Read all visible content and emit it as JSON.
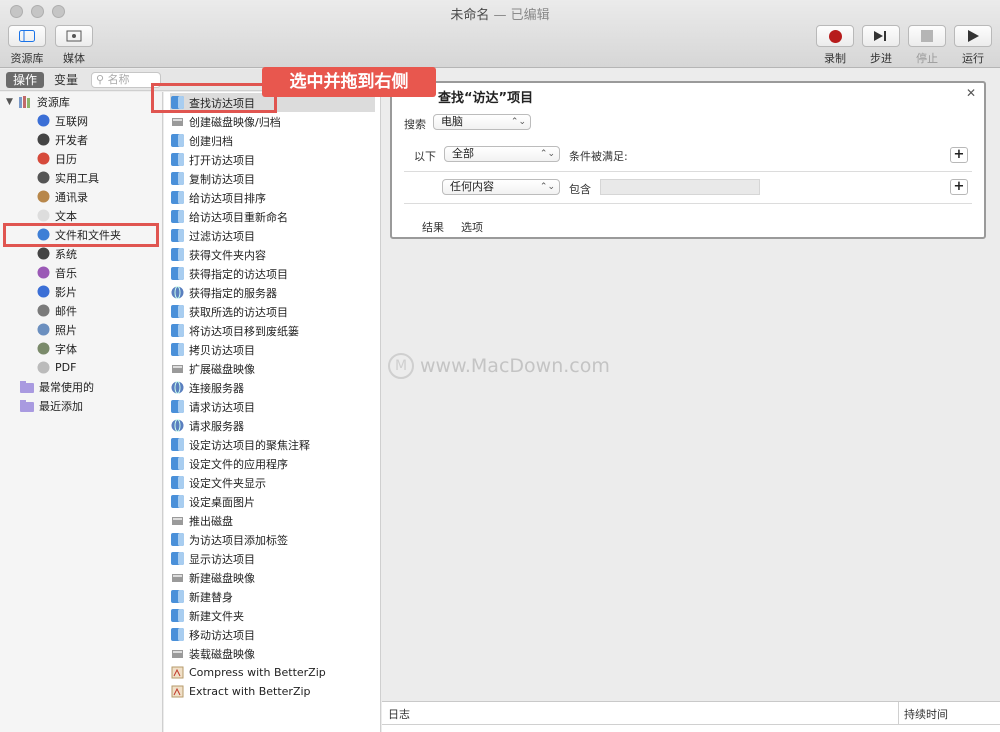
{
  "window": {
    "title": "未命名",
    "subtitle": "— 已编辑"
  },
  "toolbar": {
    "library_label": "资源库",
    "media_label": "媒体",
    "record_label": "录制",
    "step_label": "步进",
    "stop_label": "停止",
    "run_label": "运行"
  },
  "tabs": {
    "actions": "操作",
    "variables": "变量"
  },
  "search": {
    "placeholder": "名称"
  },
  "library": {
    "root": "资源库",
    "items": [
      "互联网",
      "开发者",
      "日历",
      "实用工具",
      "通讯录",
      "文本",
      "文件和文件夹",
      "系统",
      "音乐",
      "影片",
      "邮件",
      "照片",
      "字体",
      "PDF"
    ],
    "recent_used": "最常使用的",
    "recent_added": "最近添加"
  },
  "actions": [
    "查找访达项目",
    "创建磁盘映像/归档",
    "创建归档",
    "打开访达项目",
    "复制访达项目",
    "给访达项目排序",
    "给访达项目重新命名",
    "过滤访达项目",
    "获得文件夹内容",
    "获得指定的访达项目",
    "获得指定的服务器",
    "获取所选的访达项目",
    "将访达项目移到废纸篓",
    "拷贝访达项目",
    "扩展磁盘映像",
    "连接服务器",
    "请求访达项目",
    "请求服务器",
    "设定访达项目的聚焦注释",
    "设定文件的应用程序",
    "设定文件夹显示",
    "设定桌面图片",
    "推出磁盘",
    "为访达项目添加标签",
    "显示访达项目",
    "新建磁盘映像",
    "新建替身",
    "新建文件夹",
    "移动访达项目",
    "装载磁盘映像",
    "Compress with BetterZip",
    "Extract with BetterZip"
  ],
  "card": {
    "title": "查找“访达”项目",
    "search_label": "搜索",
    "search_value": "电脑",
    "below_label": "以下",
    "match_value": "全部",
    "condition_label": "条件被满足:",
    "criteria_value": "任何内容",
    "contains_label": "包含",
    "results_tab": "结果",
    "options_tab": "选项"
  },
  "watermark": "www.MacDown.com",
  "log": {
    "log_label": "日志",
    "duration_label": "持续时间"
  },
  "annotation": {
    "callout": "选中并拖到右侧"
  },
  "colors": {
    "annotation_red": "#e05550",
    "record_red": "#b71c1c"
  }
}
